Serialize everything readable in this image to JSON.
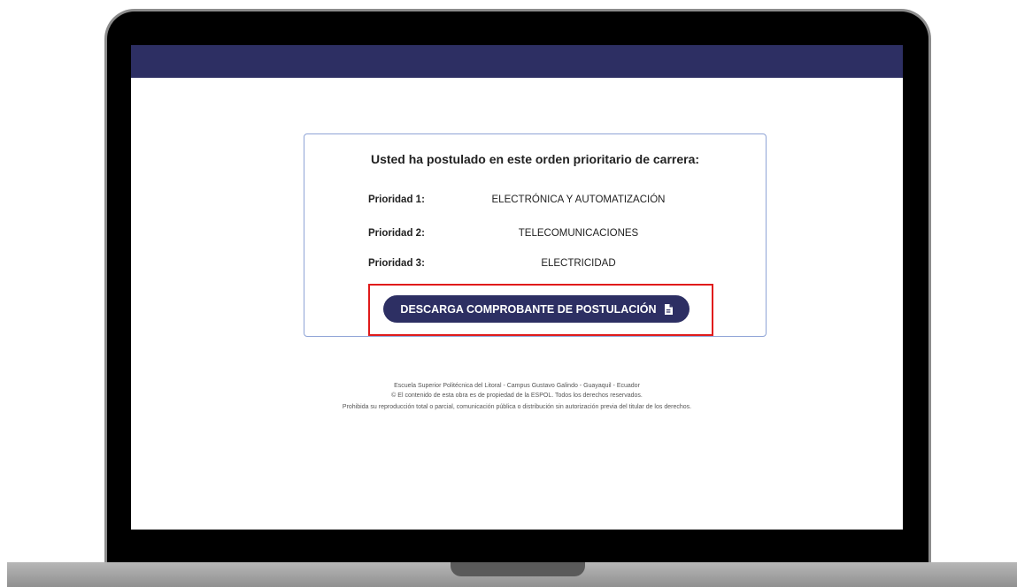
{
  "card": {
    "title": "Usted ha postulado en este orden prioritario de carrera:",
    "priorities": [
      {
        "label": "Prioridad 1:",
        "value": "ELECTRÓNICA Y AUTOMATIZACIÓN"
      },
      {
        "label": "Prioridad 2:",
        "value": "TELECOMUNICACIONES"
      },
      {
        "label": "Prioridad 3:",
        "value": "ELECTRICIDAD"
      }
    ],
    "download_button": {
      "label": "DESCARGA COMPROBANTE DE POSTULACIÓN",
      "icon": "file-icon"
    }
  },
  "footer": {
    "line1": "Escuela Superior Politécnica del Litoral - Campus Gustavo Galindo - Guayaquil - Ecuador",
    "line2": "© El contenido de esta obra es de propiedad de la ESPOL. Todos los derechos reservados.",
    "line3": "Prohibida su reproducción total o parcial, comunicación pública o distribución sin autorización previa del titular de los derechos."
  },
  "colors": {
    "header": "#2d2f63",
    "button": "#2d2f63",
    "highlight": "#e01b1b",
    "card_border": "#8ea3d6"
  }
}
